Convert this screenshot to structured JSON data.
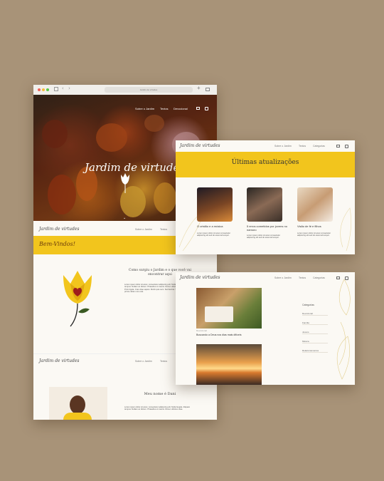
{
  "browser": {
    "url": "Jardim de virtudes"
  },
  "home": {
    "nav": [
      "Sobre o Jardim",
      "Textos",
      "Devocional"
    ],
    "title": "Jardim de virtudes",
    "logo": "Jardim de virtudes",
    "nav2": [
      "Sobre o Jardim",
      "Textos"
    ],
    "welcome": "Bem-Vindos!",
    "intro_title": "Como surgiu o Jardim e o que você vai encontrar aqui",
    "intro_text": "Lorem ipsum dolor sit amet, consectetur adipiscing elit. Nulla feugiat. Aliquam tempus. Nullam ac dictum. Phasellus ut mauris. Donec ultricies. Integer vel nisi. Proin ligula. Cras vitae sapien. Morbi quis sem. Sed lacinia. Vestibulum ante ipsum primis. Etiam non erat.",
    "logo3": "Jardim de virtudes",
    "nav3": [
      "Sobre o Jardim",
      "Textos"
    ],
    "about_title": "Meu nome é Dani",
    "about_text": "Lorem ipsum dolor sit amet, consectetur adipiscing elit. Nulla feugiat. Aliquam tempus. Nullam ac dictum. Phasellus ut mauris. Donec ultricies vitae."
  },
  "updates": {
    "logo": "Jardim de virtudes",
    "nav": [
      "Sobre o Jardim",
      "Textos",
      "Categorias"
    ],
    "heading": "Últimas atualizações",
    "cards": [
      {
        "title": "O cristão e a música",
        "excerpt": "Lorem ipsum dolor sit amet consectetur adipiscing elit sed do eiusmod tempor."
      },
      {
        "title": "5 erros cometidos por jovens no namoro",
        "excerpt": "Lorem ipsum dolor sit amet consectetur adipiscing elit sed do eiusmod tempor."
      },
      {
        "title": "Visão de fé e filhos",
        "excerpt": "Lorem ipsum dolor sit amet consectetur adipiscing elit sed do eiusmod tempor."
      }
    ]
  },
  "blog": {
    "logo": "Jardim de virtudes",
    "nav": [
      "Sobre o Jardim",
      "Textos",
      "Categorias"
    ],
    "post_tag": "Devocional",
    "post_title": "Buscando a Deus nos dias mais difíceis",
    "categories_title": "Categorias",
    "categories": [
      "Devocional",
      "Família",
      "Jovens",
      "Música",
      "Relacionamentos"
    ]
  },
  "colors": {
    "accent": "#f2c51d",
    "dark": "#333333",
    "brand_red": "#9e1c1c"
  }
}
